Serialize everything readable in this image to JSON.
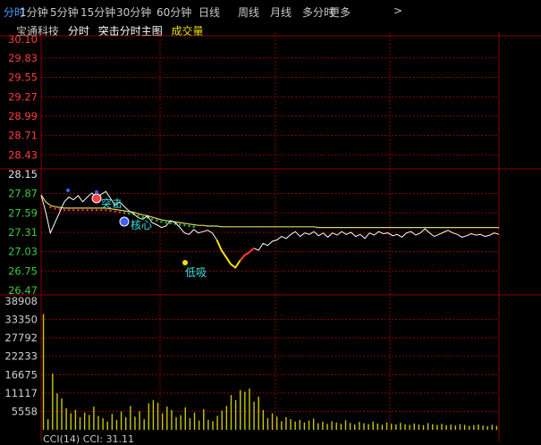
{
  "tabs": [
    {
      "label": "分时",
      "active": true
    },
    {
      "label": "1分钟",
      "active": false
    },
    {
      "label": "5分钟",
      "active": false
    },
    {
      "label": "15分钟",
      "active": false
    },
    {
      "label": "30分钟",
      "active": false
    },
    {
      "label": "60分钟",
      "active": false
    },
    {
      "label": "日线",
      "active": false
    },
    {
      "label": "周线",
      "active": false
    },
    {
      "label": "月线",
      "active": false
    },
    {
      "label": "多分时",
      "active": false
    },
    {
      "label": "更多",
      "active": false
    }
  ],
  "more_chevron": ">",
  "legend": {
    "stock_name": "宝通科技",
    "view": "分时",
    "indicator": "突击分时主图",
    "volume": "成交量"
  },
  "colors": {
    "background": "#000000",
    "grid": "#8b0000",
    "axis_up": "#ff3b3b",
    "price_line": "#ffffff",
    "avg_line": "#d8d860",
    "tab_active": "#3fa0ff",
    "volume": "#c8c800",
    "signal_label": "#40e0e0",
    "legend_indicator": "#ffffff",
    "legend_volume": "#e8e000"
  },
  "signals": {
    "attack": "突击",
    "core": "核心",
    "buy_low": "低吸"
  },
  "bottom_indicator": {
    "name": "CCI(14)",
    "value": "CCI: 31.11"
  },
  "chart_data": [
    {
      "type": "line",
      "title": "",
      "ylim": [
        26.47,
        30.1
      ],
      "y_ticks": [
        "30.10",
        "29.83",
        "29.55",
        "29.27",
        "28.99",
        "28.71",
        "28.43",
        "28.15",
        "27.87",
        "27.59",
        "27.31",
        "27.03",
        "26.75",
        "26.47"
      ],
      "series": [
        {
          "values": [
            27.85,
            27.6,
            27.3,
            27.45,
            27.6,
            27.75,
            27.82,
            27.78,
            27.84,
            27.75,
            27.82,
            27.88,
            27.8,
            27.86,
            27.9,
            27.8,
            27.7,
            27.75,
            27.68,
            27.62,
            27.58,
            27.52,
            27.5,
            27.55,
            27.45,
            27.42,
            27.38,
            27.4,
            27.48,
            27.45,
            27.38,
            27.3,
            27.28,
            27.35,
            27.3,
            27.32,
            27.34,
            27.3,
            27.2,
            27.05,
            26.95,
            26.85,
            26.8,
            26.9,
            26.98,
            27.02,
            27.08,
            27.05,
            27.15,
            27.12,
            27.18,
            27.2,
            27.25,
            27.22,
            27.28,
            27.32,
            27.25,
            27.3,
            27.28,
            27.32,
            27.26,
            27.3,
            27.24,
            27.3,
            27.27,
            27.32,
            27.28,
            27.31,
            27.25,
            27.28,
            27.22,
            27.3,
            27.27,
            27.32,
            27.29,
            27.3,
            27.26,
            27.28,
            27.24,
            27.3,
            27.32,
            27.27,
            27.3,
            27.36,
            27.3,
            27.25,
            27.28,
            27.31,
            27.34,
            27.3,
            27.28,
            27.24,
            27.26,
            27.29,
            27.27,
            27.28,
            27.25,
            27.27,
            27.3,
            27.28
          ]
        },
        {
          "values": [
            27.85,
            27.75,
            27.7,
            27.68,
            27.67,
            27.66,
            27.66,
            27.66,
            27.66,
            27.66,
            27.66,
            27.66,
            27.66,
            27.66,
            27.66,
            27.65,
            27.64,
            27.63,
            27.62,
            27.61,
            27.6,
            27.58,
            27.56,
            27.55,
            27.53,
            27.51,
            27.49,
            27.48,
            27.47,
            27.46,
            27.45,
            27.44,
            27.43,
            27.42,
            27.41,
            27.41,
            27.4,
            27.4,
            27.4,
            27.39,
            27.39,
            27.39,
            27.39,
            27.39,
            27.39,
            27.39,
            27.39,
            27.39,
            27.39,
            27.39,
            27.39,
            27.39,
            27.39,
            27.39,
            27.39,
            27.39,
            27.39,
            27.39,
            27.39,
            27.39,
            27.38,
            27.38,
            27.38,
            27.38,
            27.38,
            27.38,
            27.38,
            27.38,
            27.38,
            27.38,
            27.38,
            27.38,
            27.38,
            27.38,
            27.38,
            27.38,
            27.38,
            27.38,
            27.38,
            27.38,
            27.38,
            27.38,
            27.38,
            27.38,
            27.38,
            27.38,
            27.38,
            27.38,
            27.38,
            27.38,
            27.38,
            27.38,
            27.38,
            27.38,
            27.38,
            27.38,
            27.38,
            27.38,
            27.38,
            27.38
          ]
        }
      ]
    },
    {
      "type": "bar",
      "title": "",
      "ylim": [
        0,
        38908
      ],
      "y_ticks": [
        "38908",
        "33350",
        "27792",
        "22233",
        "16675",
        "11117",
        "5558"
      ],
      "values": [
        35000,
        3200,
        17000,
        11000,
        9500,
        6500,
        5000,
        6000,
        3800,
        5200,
        4500,
        7000,
        4200,
        3500,
        2500,
        4800,
        3000,
        5500,
        3800,
        7200,
        4000,
        5600,
        3200,
        8000,
        9000,
        8200,
        5000,
        7000,
        6000,
        3800,
        4400,
        6800,
        3500,
        5200,
        2800,
        6200,
        3000,
        2600,
        4200,
        5800,
        7200,
        10500,
        9000,
        12000,
        11500,
        12500,
        8500,
        10000,
        6000,
        3500,
        5000,
        4000,
        2600,
        3800,
        3200,
        2500,
        3000,
        2200,
        2800,
        3400,
        2000,
        2500,
        1800,
        2600,
        2200,
        1800,
        2900,
        2100,
        1600,
        2400,
        2000,
        1700,
        2500,
        1900,
        1500,
        2200,
        1800,
        1600,
        2100,
        1700,
        1500,
        1900,
        1600,
        1400,
        2000,
        1700,
        1500,
        1800,
        1400,
        1600,
        1300,
        1700,
        1500,
        1200,
        1400,
        1600,
        1300,
        1100,
        1500,
        1200
      ]
    }
  ]
}
